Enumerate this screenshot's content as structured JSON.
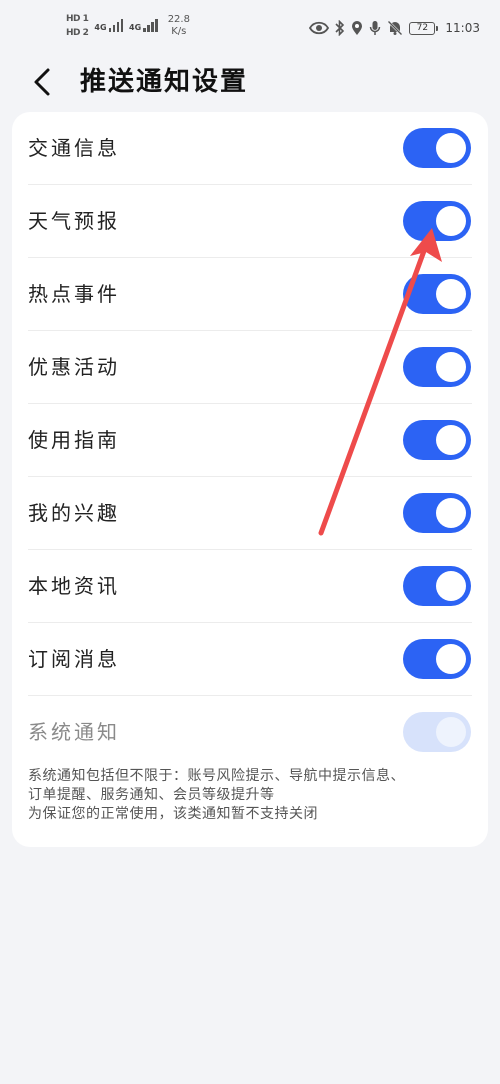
{
  "status_bar": {
    "hd1": "HD 1",
    "hd2": "HD 2",
    "net1": "4G",
    "net2": "4G",
    "speed_value": "22.8",
    "speed_unit": "K/s",
    "battery": "72",
    "time": "11:03"
  },
  "header": {
    "title": "推送通知设置"
  },
  "settings": {
    "items": [
      {
        "label": "交通信息",
        "enabled": true
      },
      {
        "label": "天气预报",
        "enabled": true
      },
      {
        "label": "热点事件",
        "enabled": true
      },
      {
        "label": "优惠活动",
        "enabled": true
      },
      {
        "label": "使用指南",
        "enabled": true
      },
      {
        "label": "我的兴趣",
        "enabled": true
      },
      {
        "label": "本地资讯",
        "enabled": true
      },
      {
        "label": "订阅消息",
        "enabled": true
      },
      {
        "label": "系统通知",
        "enabled": true,
        "disabled": true
      }
    ],
    "footnote": {
      "line1": "系统通知包括但不限于：账号风险提示、导航中提示信息、",
      "line2": "订单提醒、服务通知、会员等级提升等",
      "line3": "为保证您的正常使用，该类通知暂不支持关闭"
    }
  },
  "colors": {
    "toggle_on": "#2c63f4",
    "toggle_disabled": "#d7e2fb",
    "arrow": "#ee4b4b"
  }
}
